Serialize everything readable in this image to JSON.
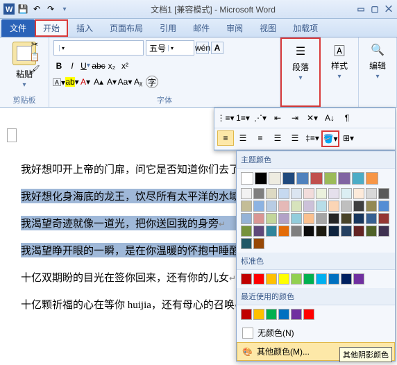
{
  "titlebar": {
    "doc_title": "文档1 [兼容模式] - Microsoft Word"
  },
  "tabs": {
    "file": "文件",
    "home": "开始",
    "insert": "插入",
    "layout": "页面布局",
    "ref": "引用",
    "mail": "邮件",
    "review": "审阅",
    "view": "视图",
    "addin": "加载项"
  },
  "ribbon": {
    "clipboard": {
      "paste": "粘贴",
      "label": "剪贴板"
    },
    "font": {
      "size": "五号",
      "label": "字体"
    },
    "paragraph": {
      "btn": "段落"
    },
    "styles": {
      "btn": "样式"
    },
    "editing": {
      "btn": "编辑"
    }
  },
  "doc": {
    "l1": "我好想叩开上帝的门扉，问它是否知道你们去了何方",
    "l2": "我好想化身海底的龙王，饮尽所有太平洋的水域",
    "l3": "我渴望奇迹就像一道光，把你送回我的身旁",
    "l4": "我渴望睁开眼的一瞬，是在你温暖的怀抱中睡醒",
    "l5": "十亿双期盼的目光在签你回来，还有你的儿女",
    "l6": "十亿颗祈福的心在等你 huijia，还有母心的召唤"
  },
  "colorpop": {
    "theme": "主题颜色",
    "standard": "标准色",
    "recent": "最近使用的颜色",
    "nocolor": "无颜色(N)",
    "more": "其他颜色(M)...",
    "tooltip": "其他阴影颜色"
  },
  "colors": {
    "theme_row": [
      "#ffffff",
      "#000000",
      "#eeece1",
      "#1f497d",
      "#4f81bd",
      "#c0504d",
      "#9bbb59",
      "#8064a2",
      "#4bacc6",
      "#f79646"
    ],
    "theme_shades": [
      [
        "#f2f2f2",
        "#7f7f7f",
        "#ddd9c3",
        "#c6d9f0",
        "#dbe5f1",
        "#f2dcdb",
        "#ebf1dd",
        "#e5e0ec",
        "#dbeef3",
        "#fdeada"
      ],
      [
        "#d8d8d8",
        "#595959",
        "#c4bd97",
        "#8db3e2",
        "#b8cce4",
        "#e5b9b7",
        "#d7e3bc",
        "#ccc1d9",
        "#b7dde8",
        "#fbd5b5"
      ],
      [
        "#bfbfbf",
        "#3f3f3f",
        "#938953",
        "#548dd4",
        "#95b3d7",
        "#d99694",
        "#c3d69b",
        "#b2a2c7",
        "#92cddc",
        "#fac08f"
      ],
      [
        "#a5a5a5",
        "#262626",
        "#494429",
        "#17365d",
        "#366092",
        "#953734",
        "#76923c",
        "#5f497a",
        "#31859b",
        "#e36c09"
      ],
      [
        "#7f7f7f",
        "#0c0c0c",
        "#1d1b10",
        "#0f243e",
        "#244061",
        "#632423",
        "#4f6128",
        "#3f3151",
        "#205867",
        "#974806"
      ]
    ],
    "standard": [
      "#c00000",
      "#ff0000",
      "#ffc000",
      "#ffff00",
      "#92d050",
      "#00b050",
      "#00b0f0",
      "#0070c0",
      "#002060",
      "#7030a0"
    ],
    "recent": [
      "#c00000",
      "#ffc000",
      "#00b050",
      "#0070c0",
      "#7030a0",
      "#ff0000"
    ]
  }
}
